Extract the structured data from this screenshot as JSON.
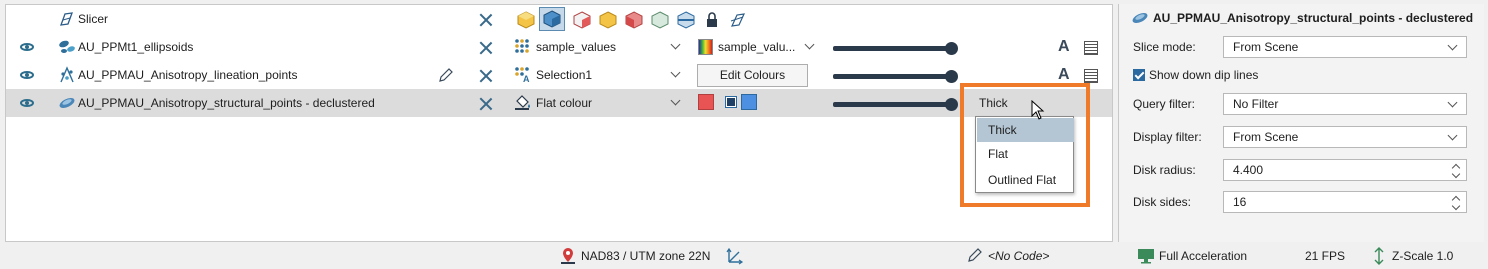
{
  "scene_list": {
    "rows": [
      {
        "name": "Slicer",
        "visible": false
      },
      {
        "name": "AU_PPMt1_ellipsoids",
        "visible": true,
        "colour_attribute": "sample_values",
        "colour_scheme": "sample_valu..."
      },
      {
        "name": "AU_PPMAU_Anisotropy_lineation_points",
        "visible": true,
        "colour_attribute": "Selection1",
        "edit_colours_label": "Edit Colours"
      },
      {
        "name": "AU_PPMAU_Anisotropy_structural_points - declustered",
        "visible": true,
        "colour_attribute": "Flat colour",
        "display_type": "Thick",
        "flat_colour": "#e85454",
        "second_colour": "#4d8fe0"
      }
    ]
  },
  "display_type_menu": {
    "options": [
      "Thick",
      "Flat",
      "Outlined Flat"
    ],
    "selected": "Thick"
  },
  "properties": {
    "title": "AU_PPMAU_Anisotropy_structural_points - declustered",
    "slice_mode_label": "Slice mode:",
    "slice_mode_value": "From Scene",
    "show_down_dip_label": "Show down dip lines",
    "show_down_dip_checked": true,
    "query_filter_label": "Query filter:",
    "query_filter_value": "No Filter",
    "display_filter_label": "Display filter:",
    "display_filter_value": "From Scene",
    "disk_radius_label": "Disk radius:",
    "disk_radius_value": "4.400",
    "disk_sides_label": "Disk sides:",
    "disk_sides_value": "16"
  },
  "status_bar": {
    "projection": "NAD83 / UTM zone 22N",
    "code": "<No Code>",
    "acceleration": "Full Acceleration",
    "fps": "21 FPS",
    "zscale": "Z-Scale 1.0"
  },
  "colors": {
    "accent_highlight": "#ef7a2a",
    "selected_row": "#dcdcdc",
    "menu_active": "#b4c6d4"
  }
}
